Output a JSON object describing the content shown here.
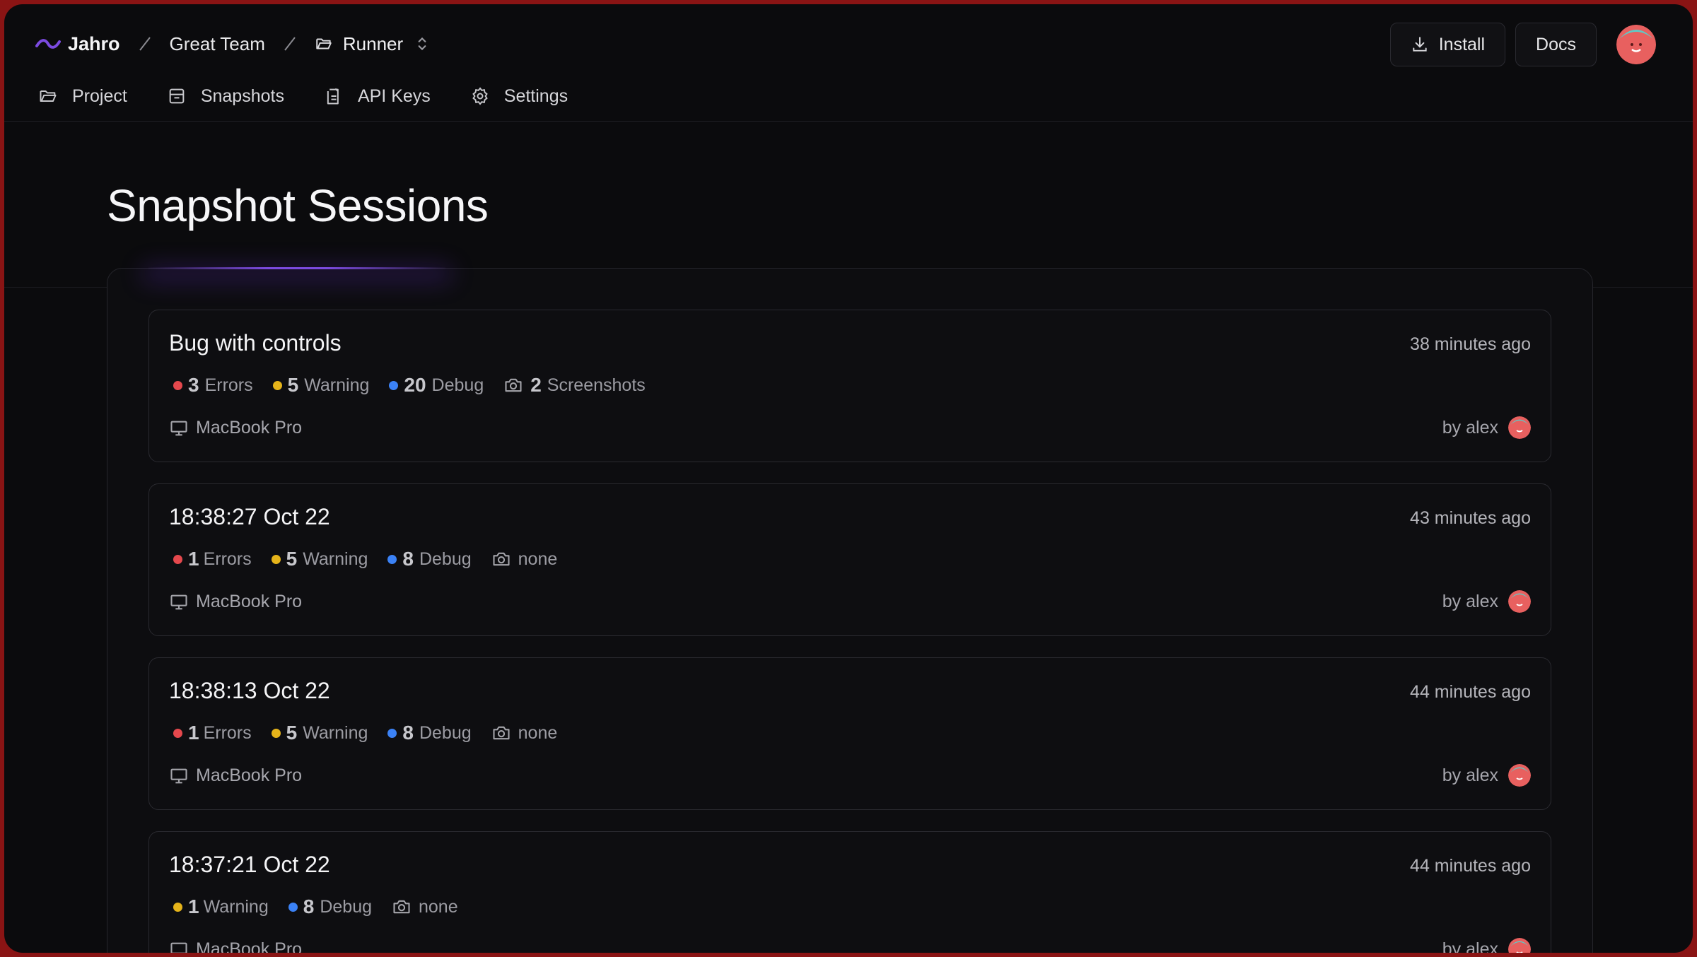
{
  "header": {
    "brand": "Jahro",
    "team": "Great Team",
    "project": "Runner",
    "install_label": "Install",
    "docs_label": "Docs"
  },
  "nav": [
    {
      "label": "Project",
      "icon": "folder-icon"
    },
    {
      "label": "Snapshots",
      "icon": "inbox-icon"
    },
    {
      "label": "API Keys",
      "icon": "clipboard-icon"
    },
    {
      "label": "Settings",
      "icon": "gear-icon"
    }
  ],
  "page": {
    "title": "Snapshot Sessions"
  },
  "sessions": [
    {
      "title": "Bug with controls",
      "time": "38 minutes ago",
      "errors": "3",
      "errors_label": "Errors",
      "warning": "5",
      "warning_label": "Warning",
      "debug": "20",
      "debug_label": "Debug",
      "screenshots": "2",
      "screenshots_label": "Screenshots",
      "device": "MacBook Pro",
      "author": "by alex"
    },
    {
      "title": "18:38:27 Oct 22",
      "time": "43 minutes ago",
      "errors": "1",
      "errors_label": "Errors",
      "warning": "5",
      "warning_label": "Warning",
      "debug": "8",
      "debug_label": "Debug",
      "screenshots_label": "none",
      "device": "MacBook Pro",
      "author": "by alex"
    },
    {
      "title": "18:38:13 Oct 22",
      "time": "44 minutes ago",
      "errors": "1",
      "errors_label": "Errors",
      "warning": "5",
      "warning_label": "Warning",
      "debug": "8",
      "debug_label": "Debug",
      "screenshots_label": "none",
      "device": "MacBook Pro",
      "author": "by alex"
    },
    {
      "title": "18:37:21 Oct 22",
      "time": "44 minutes ago",
      "warning": "1",
      "warning_label": "Warning",
      "debug": "8",
      "debug_label": "Debug",
      "screenshots_label": "none",
      "device": "MacBook Pro",
      "author": "by alex"
    }
  ],
  "colors": {
    "error": "#e5484d",
    "warning": "#e6b41a",
    "debug": "#3b82f6",
    "accent": "#7c4be0",
    "avatar": "#e8605f",
    "avatar_hair": "#5fc9c6"
  }
}
